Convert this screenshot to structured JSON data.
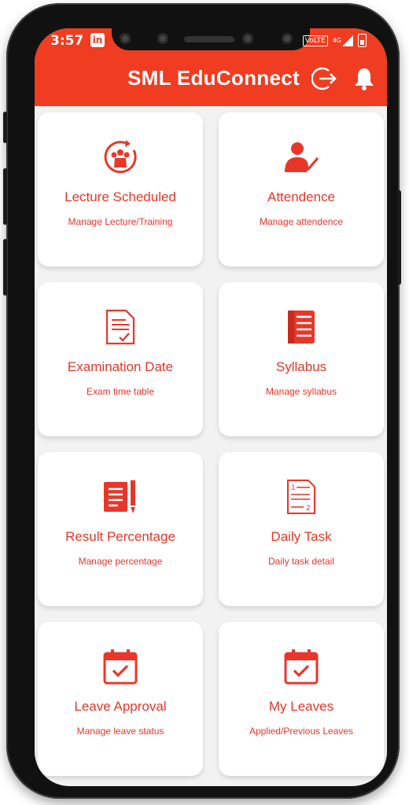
{
  "status_bar": {
    "time": "3:57",
    "linkedin_label": "in",
    "network_label": "VoLTE",
    "signal_label": "4G"
  },
  "header": {
    "title": "SML EduConnect"
  },
  "icons": {
    "logout": "logout-icon",
    "notifications": "bell-icon"
  },
  "colors": {
    "brand": "#f03c20",
    "text_accent": "#e8372a",
    "card_bg": "#ffffff",
    "page_bg": "#f2f2f2"
  },
  "cards": [
    {
      "title": "Lecture Scheduled",
      "subtitle": "Manage Lecture/Training",
      "icon": "group-refresh-icon"
    },
    {
      "title": "Attendence",
      "subtitle": "Manage attendence",
      "icon": "user-check-icon"
    },
    {
      "title": "Examination Date",
      "subtitle": "Exam time table",
      "icon": "document-check-icon"
    },
    {
      "title": "Syllabus",
      "subtitle": "Manage syllabus",
      "icon": "list-book-icon"
    },
    {
      "title": "Result Percentage",
      "subtitle": "Manage percentage",
      "icon": "report-pen-icon"
    },
    {
      "title": "Daily Task",
      "subtitle": "Daily task detail",
      "icon": "task-sheet-icon"
    },
    {
      "title": "Leave Approval",
      "subtitle": "Manage leave status",
      "icon": "calendar-check-icon"
    },
    {
      "title": "My Leaves",
      "subtitle": "Applied/Previous Leaves",
      "icon": "calendar-check-icon"
    }
  ]
}
